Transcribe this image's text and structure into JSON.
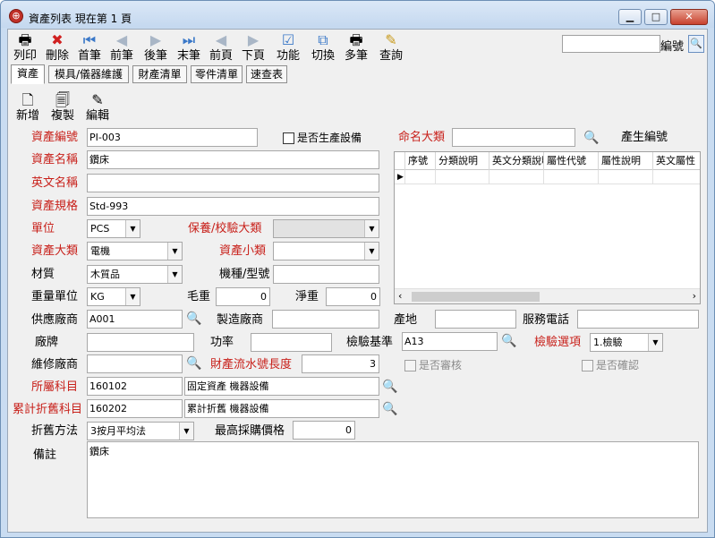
{
  "window": {
    "app_icon": "globe-icon",
    "title": "資產列表 現在第 1 頁",
    "controls": {
      "minimize": "minimize-icon",
      "maximize": "maximize-icon",
      "close": "close-icon"
    }
  },
  "toolbar": {
    "print": "列印",
    "delete": "刪除",
    "first": "首筆",
    "prev": "前筆",
    "next": "後筆",
    "last": "末筆",
    "prev_page": "前頁",
    "next_page": "下頁",
    "function": "功能",
    "switch": "切換",
    "multi": "多筆",
    "query": "查詢",
    "search_value": "",
    "search_label": "編號"
  },
  "tabs": [
    "資產",
    "模具/儀器維護",
    "財產清單",
    "零件清單",
    "速查表"
  ],
  "subtoolbar": {
    "new": "新增",
    "copy": "複製",
    "edit": "編輯"
  },
  "form": {
    "asset_no": {
      "label": "資產編號",
      "value": "PI-003"
    },
    "is_production": {
      "label": "是否生產設備",
      "checked": false
    },
    "asset_name": {
      "label": "資產名稱",
      "value": "鑽床"
    },
    "english_name": {
      "label": "英文名稱",
      "value": ""
    },
    "spec": {
      "label": "資產規格",
      "value": "Std-993"
    },
    "unit": {
      "label": "單位",
      "value": "PCS"
    },
    "maint_category": {
      "label": "保養/校驗大類",
      "value": ""
    },
    "asset_category": {
      "label": "資產大類",
      "value": "電機"
    },
    "asset_subcategory": {
      "label": "資產小類",
      "value": ""
    },
    "material": {
      "label": "材質",
      "value": "木質品"
    },
    "model": {
      "label": "機種/型號",
      "value": ""
    },
    "weight_unit": {
      "label": "重量單位",
      "value": "KG"
    },
    "gross_weight": {
      "label": "毛重",
      "value": "0"
    },
    "net_weight": {
      "label": "淨重",
      "value": "0"
    },
    "supplier": {
      "label": "供應廠商",
      "value": "A001"
    },
    "manufacturer": {
      "label": "製造廠商",
      "value": ""
    },
    "origin": {
      "label": "產地",
      "value": ""
    },
    "service_phone": {
      "label": "服務電話",
      "value": ""
    },
    "brand": {
      "label": "廠牌",
      "value": ""
    },
    "power": {
      "label": "功率",
      "value": ""
    },
    "inspection_standard": {
      "label": "檢驗基準",
      "value": "A13"
    },
    "inspection_option": {
      "label": "檢驗選項",
      "value": "1.檢驗"
    },
    "repair_vendor": {
      "label": "維修廠商",
      "value": ""
    },
    "serial_length": {
      "label": "財產流水號長度",
      "value": "3"
    },
    "is_reviewed": {
      "label": "是否審核",
      "checked": false
    },
    "is_confirmed": {
      "label": "是否確認",
      "checked": false
    },
    "account": {
      "label": "所屬科目",
      "code": "160102",
      "name": "固定資產 機器設備"
    },
    "depr_account": {
      "label": "累計折舊科目",
      "code": "160202",
      "name": "累計折舊 機器設備"
    },
    "depreciation_method": {
      "label": "折舊方法",
      "value": "3按月平均法"
    },
    "max_price": {
      "label": "最高採購價格",
      "value": "0"
    },
    "remarks": {
      "label": "備註",
      "value": "鑽床"
    }
  },
  "naming": {
    "label": "命名大類",
    "value": "",
    "generate_label": "產生編號",
    "columns": [
      "序號",
      "分類說明",
      "英文分類說明",
      "屬性代號",
      "屬性說明",
      "英文屬性"
    ]
  }
}
